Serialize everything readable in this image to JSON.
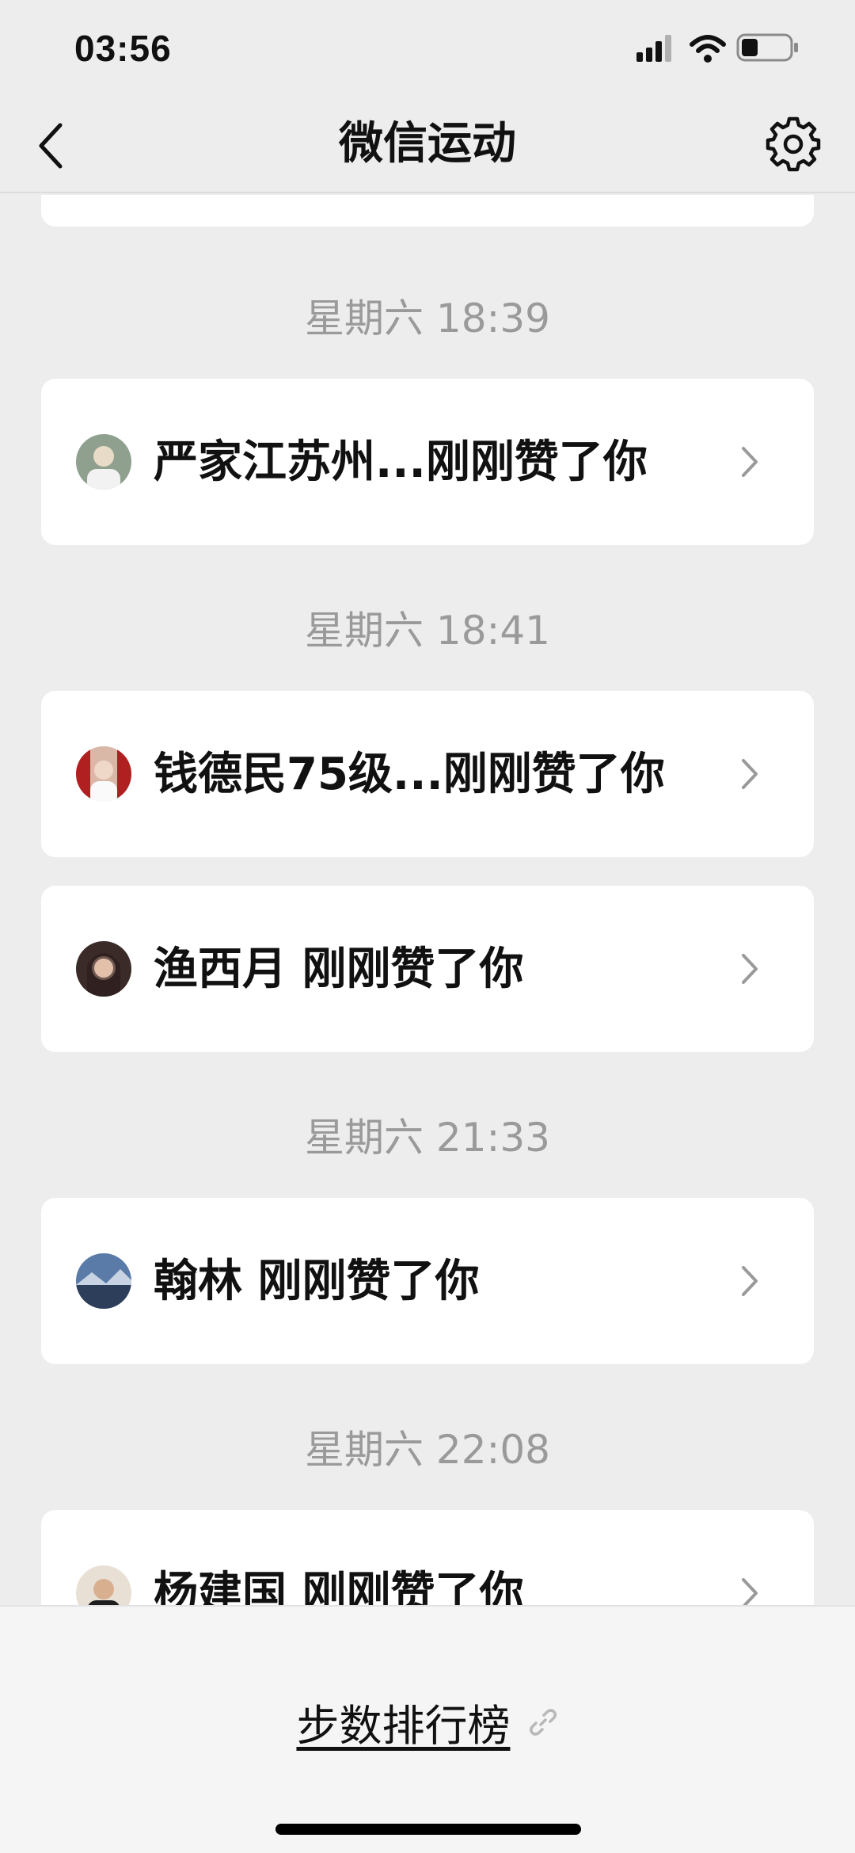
{
  "status": {
    "time": "03:56"
  },
  "nav": {
    "title": "微信运动"
  },
  "feed": {
    "groups": [
      {
        "time": "星期六 18:39",
        "items": [
          {
            "text": "严家江苏州...刚刚赞了你",
            "avatar_color": "#7a8a7a"
          }
        ]
      },
      {
        "time": "星期六 18:41",
        "items": [
          {
            "text": "钱德民75级...刚刚赞了你",
            "avatar_color": "#c8a898"
          },
          {
            "text": "渔西月 刚刚赞了你",
            "avatar_color": "#6a4a44"
          }
        ]
      },
      {
        "time": "星期六 21:33",
        "items": [
          {
            "text": "翰林 刚刚赞了你",
            "avatar_color": "#4a6890"
          }
        ]
      },
      {
        "time": "星期六 22:08",
        "items": [
          {
            "text": "杨建国 刚刚赞了你",
            "avatar_color": "#5a5048"
          }
        ]
      }
    ]
  },
  "bottom": {
    "rank_label": "步数排行榜"
  }
}
